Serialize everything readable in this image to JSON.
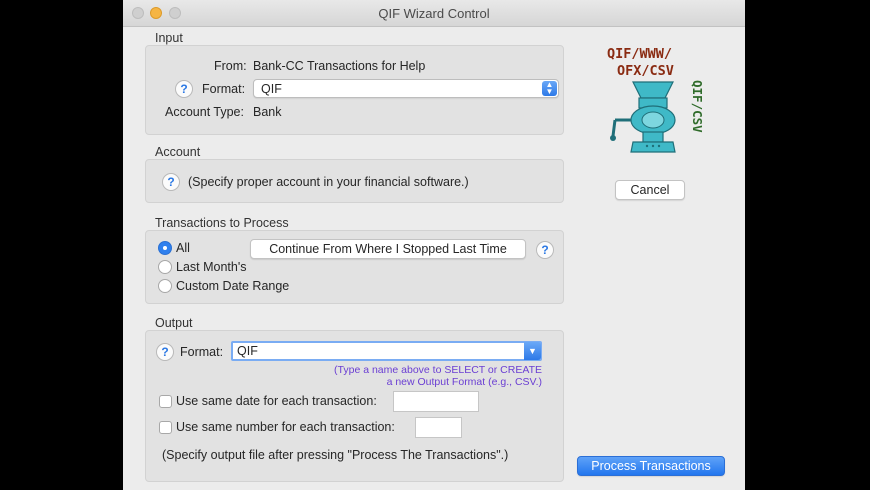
{
  "window": {
    "title": "QIF Wizard Control"
  },
  "input": {
    "section_label": "Input",
    "from_label": "From:",
    "from_value": "Bank-CC Transactions for Help",
    "format_label": "Format:",
    "format_value": "QIF",
    "account_type_label": "Account Type:",
    "account_type_value": "Bank",
    "help_glyph": "?"
  },
  "account": {
    "section_label": "Account",
    "hint": "(Specify proper account in your financial software.)",
    "help_glyph": "?"
  },
  "transactions": {
    "section_label": "Transactions to Process",
    "options": [
      {
        "label": "All",
        "selected": true
      },
      {
        "label": "Last Month's",
        "selected": false
      },
      {
        "label": "Custom Date Range",
        "selected": false
      }
    ],
    "continue_button": "Continue From Where I Stopped Last Time",
    "help_glyph": "?"
  },
  "output": {
    "section_label": "Output",
    "format_label": "Format:",
    "format_value": "QIF",
    "hint_line1": "(Type a name above to SELECT or CREATE",
    "hint_line2": "a new Output Format (e.g., CSV.)",
    "same_date_label": "Use same date for each transaction:",
    "same_date_value": "",
    "same_number_label": "Use same number for each transaction:",
    "same_number_value": "",
    "footer_note": "(Specify output file after pressing \"Process The Transactions\".)",
    "help_glyph": "?"
  },
  "logo": {
    "line1": "QIF/WWW/",
    "line2": "OFX/CSV",
    "vertical": "QIF/CSV"
  },
  "buttons": {
    "cancel": "Cancel",
    "process": "Process Transactions"
  },
  "colors": {
    "accent": "#2f80ee",
    "hint_text": "#6b3fd3",
    "logo_red": "#8a2b12",
    "logo_green": "#2f6b2a",
    "grinder": "#3fb9c7"
  }
}
